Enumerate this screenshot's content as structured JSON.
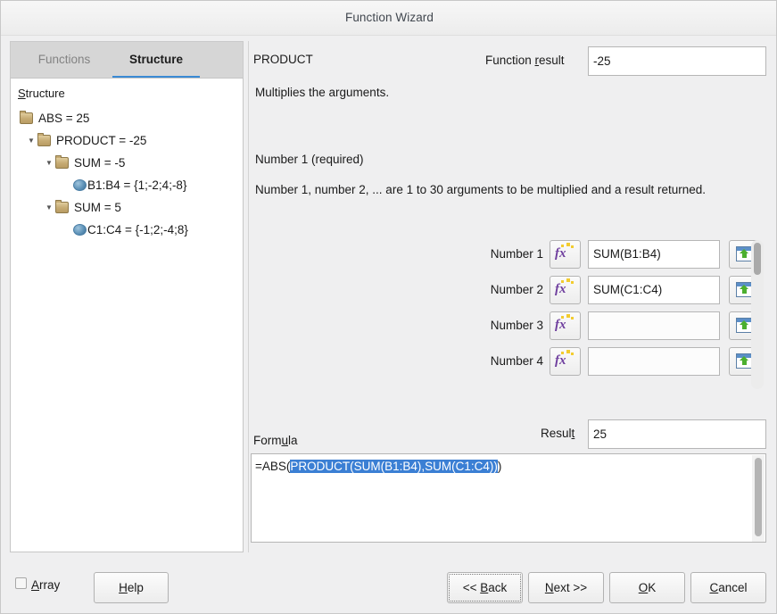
{
  "window": {
    "title": "Function Wizard"
  },
  "tabs": [
    {
      "label": "Functions",
      "active": false
    },
    {
      "label": "Structure",
      "active": true
    }
  ],
  "structure": {
    "heading": "Structure",
    "heading_accesskey": "S",
    "nodes": [
      {
        "label": "ABS = 25",
        "depth": 0,
        "icon": "folder-icon",
        "twisty": "none"
      },
      {
        "label": "PRODUCT = -25",
        "depth": 1,
        "icon": "folder-icon",
        "twisty": "expanded"
      },
      {
        "label": "SUM = -5",
        "depth": 2,
        "icon": "folder-icon",
        "twisty": "expanded"
      },
      {
        "label": "B1:B4 = {1;-2;4;-8}",
        "depth": 3,
        "icon": "bullet-icon",
        "twisty": "none"
      },
      {
        "label": "SUM = 5",
        "depth": 2,
        "icon": "folder-icon",
        "twisty": "expanded"
      },
      {
        "label": "C1:C4 = {-1;2;-4;8}",
        "depth": 3,
        "icon": "bullet-icon",
        "twisty": "none"
      }
    ]
  },
  "details": {
    "function_name": "PRODUCT",
    "function_result_label": "Function result",
    "function_result_accesskey": "r",
    "function_result_value": "-25",
    "summary": "Multiplies the arguments.",
    "argument_title": "Number 1 (required)",
    "argument_description": "Number 1, number 2, ... are 1 to 30 arguments to be multiplied and a result returned."
  },
  "arguments": [
    {
      "label": "Number 1",
      "value": "SUM(B1:B4)",
      "placeholder": ""
    },
    {
      "label": "Number 2",
      "value": "SUM(C1:C4)",
      "placeholder": ""
    },
    {
      "label": "Number 3",
      "value": "",
      "placeholder": ""
    },
    {
      "label": "Number 4",
      "value": "",
      "placeholder": ""
    }
  ],
  "formula": {
    "label": "Formula",
    "label_accesskey": "u",
    "prefix": "=ABS(",
    "selected": "PRODUCT(SUM(B1:B4),SUM(C1:C4))",
    "suffix": ")",
    "full_text": "=ABS(PRODUCT(SUM(B1:B4),SUM(C1:C4)))"
  },
  "result": {
    "label": "Result",
    "label_accesskey": "t",
    "value": "25"
  },
  "footer": {
    "array_label": "Array",
    "array_accesskey": "A",
    "array_checked": false,
    "help_label": "Help",
    "help_accesskey": "H",
    "back_label": "<< Back",
    "back_accesskey": "B",
    "next_label": "Next >>",
    "next_accesskey": "N",
    "ok_label": "OK",
    "ok_accesskey": "O",
    "cancel_label": "Cancel",
    "cancel_accesskey": "C"
  },
  "colors": {
    "accent": "#3a8ad4",
    "selection": "#3b7fd4",
    "dialog_bg": "#efeff0",
    "field_bg": "#ffffff",
    "folder_icon": "#c5aa72",
    "fx_icon": "#6f3f9e"
  }
}
